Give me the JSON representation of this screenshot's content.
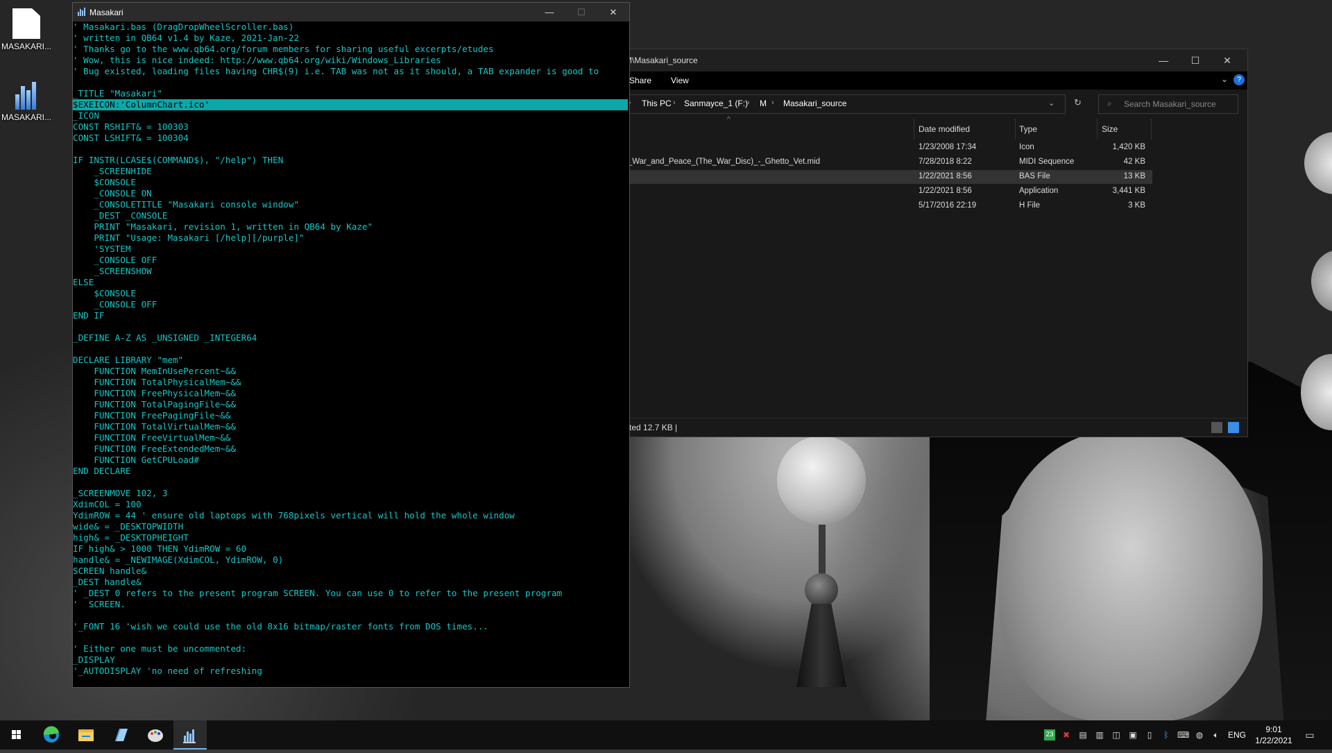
{
  "desktop": {
    "icons": [
      {
        "label": "MASAKARI...",
        "icon": "file-icon"
      },
      {
        "label": "MASAKARI...",
        "icon": "column-chart-app-icon"
      }
    ]
  },
  "qb_window": {
    "title": "Masakari",
    "controls": {
      "minimize": "—",
      "maximize": "☐",
      "close": "✕"
    },
    "code_lines": [
      "' Masakari.bas (DragDropWheelScroller.bas)",
      "' written in QB64 v1.4 by Kaze, 2021-Jan-22",
      "' Thanks go to the www.qb64.org/forum members for sharing useful excerpts/etudes",
      "' Wow, this is nice indeed: http://www.qb64.org/wiki/Windows_Libraries",
      "' Bug existed, loading files having CHR$(9) i.e. TAB was not as it should, a TAB expander is good to",
      "",
      "_TITLE \"Masakari\"",
      "$EXEICON:'ColumnChart.ico'",
      "_ICON",
      "CONST RSHIFT& = 100303",
      "CONST LSHIFT& = 100304",
      "",
      "IF INSTR(LCASE$(COMMAND$), \"/help\") THEN",
      "    _SCREENHIDE",
      "    $CONSOLE",
      "    _CONSOLE ON",
      "    _CONSOLETITLE \"Masakari console window\"",
      "    _DEST _CONSOLE",
      "    PRINT \"Masakari, revision 1, written in QB64 by Kaze\"",
      "    PRINT \"Usage: Masakari [/help][/purple]\"",
      "    'SYSTEM",
      "    _CONSOLE OFF",
      "    _SCREENSHOW",
      "ELSE",
      "    $CONSOLE",
      "    _CONSOLE OFF",
      "END IF",
      "",
      "_DEFINE A-Z AS _UNSIGNED _INTEGER64",
      "",
      "DECLARE LIBRARY \"mem\"",
      "    FUNCTION MemInUsePercent~&&",
      "    FUNCTION TotalPhysicalMem~&&",
      "    FUNCTION FreePhysicalMem~&&",
      "    FUNCTION TotalPagingFile~&&",
      "    FUNCTION FreePagingFile~&&",
      "    FUNCTION TotalVirtualMem~&&",
      "    FUNCTION FreeVirtualMem~&&",
      "    FUNCTION FreeExtendedMem~&&",
      "    FUNCTION GetCPULoad#",
      "END DECLARE",
      "",
      "_SCREENMOVE 102, 3",
      "XdimCOL = 100",
      "YdimROW = 44 ' ensure old laptops with 768pixels vertical will hold the whole window",
      "wide& = _DESKTOPWIDTH",
      "high& = _DESKTOPHEIGHT",
      "IF high& > 1000 THEN YdimROW = 60",
      "handle& = _NEWIMAGE(XdimCOL, YdimROW, 0)",
      "SCREEN handle&",
      "_DEST handle&",
      "' _DEST 0 refers to the present program SCREEN. You can use 0 to refer to the present program",
      "'  SCREEN.",
      "",
      "'_FONT 16 'wish we could use the old 8x16 bitmap/raster fonts from DOS times...",
      "",
      "' Either one must be uncommented:",
      "_DISPLAY",
      "'_AUTODISPLAY 'no need of refreshing"
    ],
    "highlighted_line": 7
  },
  "explorer": {
    "title_partial": "M\\Masakari_source",
    "ribbon": {
      "share": "Share",
      "view": "View",
      "help": "?"
    },
    "breadcrumbs": [
      "This PC",
      "Sanmayce_1 (F:)",
      "M",
      "Masakari_source"
    ],
    "search_placeholder": "Search Masakari_source",
    "columns": {
      "date": "Date modified",
      "type": "Type",
      "size": "Size"
    },
    "files": [
      {
        "name": "",
        "date": "1/23/2008 17:34",
        "type": "Icon",
        "size": "1,420 KB",
        "selected": false
      },
      {
        "name": "-_War_and_Peace_(The_War_Disc)_-_Ghetto_Vet.mid",
        "date": "7/28/2018 8:22",
        "type": "MIDI Sequence",
        "size": "42 KB",
        "selected": false
      },
      {
        "name": "",
        "date": "1/22/2021 8:56",
        "type": "BAS File",
        "size": "13 KB",
        "selected": true
      },
      {
        "name": "",
        "date": "1/22/2021 8:56",
        "type": "Application",
        "size": "3,441 KB",
        "selected": false
      },
      {
        "name": "",
        "date": "5/17/2016 22:19",
        "type": "H File",
        "size": "3 KB",
        "selected": false
      }
    ],
    "status": "cted  12.7 KB  |"
  },
  "taskbar": {
    "apps": [
      "windows-start-icon",
      "edge-icon",
      "file-explorer-icon",
      "notepad-icon",
      "paint-icon",
      "qb64-masakari-icon"
    ],
    "tray_badge": "23",
    "language": "ENG",
    "time": "9:01",
    "date": "1/22/2021"
  },
  "colors": {
    "code_text": "#16c6c6",
    "highlight_bg": "#0aa8a8",
    "accent": "#76b9ed"
  }
}
